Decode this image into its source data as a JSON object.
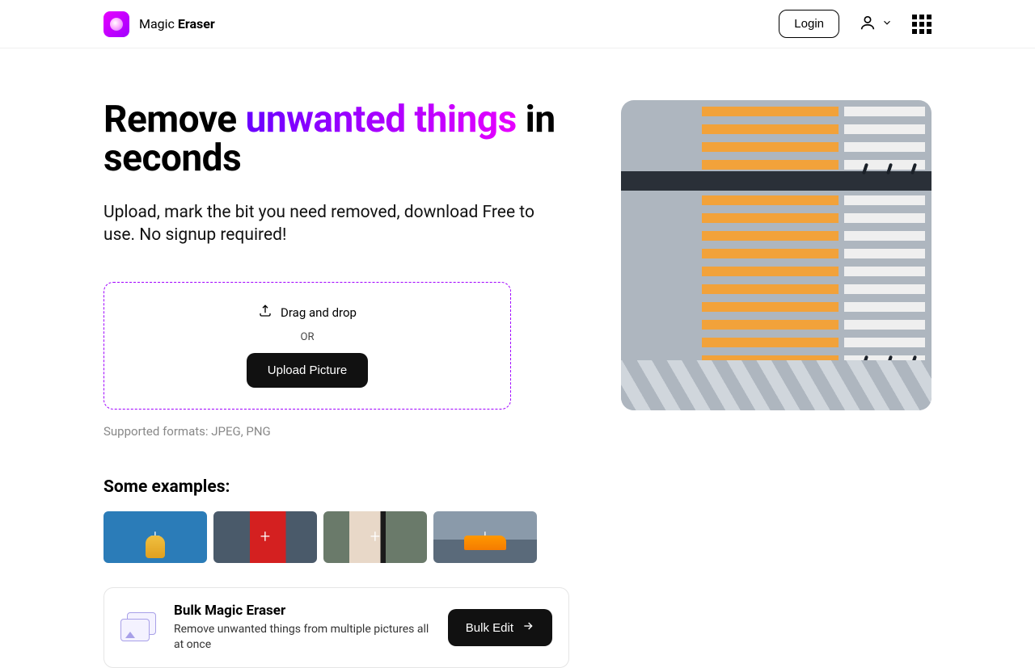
{
  "header": {
    "brand_left": "Magic ",
    "brand_right": "Eraser",
    "login": "Login"
  },
  "hero": {
    "title_pre": "Remove ",
    "title_grad": "unwanted things",
    "title_post": " in seconds",
    "sub": "Upload, mark the bit you need removed, download Free to use. No signup required!"
  },
  "drop": {
    "drag": "Drag and drop",
    "or": "OR",
    "upload": "Upload Picture",
    "formats": "Supported formats: JPEG, PNG"
  },
  "examples": {
    "heading": "Some examples:"
  },
  "bulk": {
    "title": "Bulk Magic Eraser",
    "sub": "Remove unwanted things from multiple pictures all at once",
    "cta": "Bulk Edit"
  }
}
